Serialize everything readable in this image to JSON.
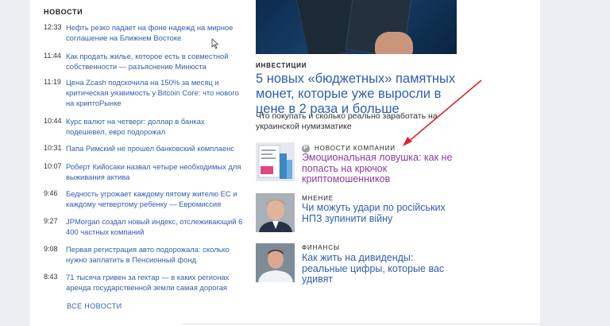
{
  "news": {
    "heading": "НОВОСТИ",
    "items": [
      {
        "time": "12:33",
        "title": "Нефть резко падает на фоне надежд на мирное соглашение на Ближнем Востоке"
      },
      {
        "time": "11:44",
        "title": "Как продать жилье, которое есть в совместной собственности — разъяснение Минюста"
      },
      {
        "time": "11:19",
        "title": "Цена Zcash подскочила на 150% за месяц и критическая уязвимость у Bitcoin Core: что нового на криптоРынке"
      },
      {
        "time": "10:44",
        "title": "Курс валют на четверг: доллар в банках подешевел, евро подорожал"
      },
      {
        "time": "10:31",
        "title": "Папа Римский не прошел банковский комплаенс"
      },
      {
        "time": "10:07",
        "title": "Роберт Кийосаки назвал четыре необходимых для выживания актива"
      },
      {
        "time": "9:46",
        "title": "Бедность угрожает каждому пятому жителю ЕС и каждому четвертому ребенку — Евромиссия"
      },
      {
        "time": "9:27",
        "title": "JPMorgan создал новый индекс, отслеживающий 6 400 частных компаний"
      },
      {
        "time": "9:08",
        "title": "Первая регистрация авто подорожала: сколько нужно заплатить в Пенсионный фонд"
      },
      {
        "time": "8:43",
        "title": "71 тысяча гривен за гектар — в каких регионах аренда государственной земли самая дорогая"
      }
    ],
    "all_label": "ВСЕ НОВОСТИ"
  },
  "featured": {
    "rubric": "ИНВЕСТИЦИИ",
    "title": "5 новых «бюджетных» памятных монет, которые уже выросли в цене в 2 раза и больше",
    "lead": "Что покупать и сколько реально заработать на украинской нумизматике"
  },
  "cards": [
    {
      "badge": "Р",
      "rubric": "НОВОСТИ КОМПАНИИ",
      "title": "Эмоциональная ловушка: как не попасть на крючок криптомошенников"
    },
    {
      "rubric": "МНЕНИЕ",
      "title": "Чи можуть удари по російських НПЗ зупинити війну"
    },
    {
      "rubric": "ФИНАНСЫ",
      "title": "Как жить на дивиденды: реальные цифры, которые вас удивят"
    }
  ],
  "colors": {
    "link": "#2f5fb0",
    "visited": "#8a3c9f",
    "annotation_arrow": "#d9262c"
  }
}
